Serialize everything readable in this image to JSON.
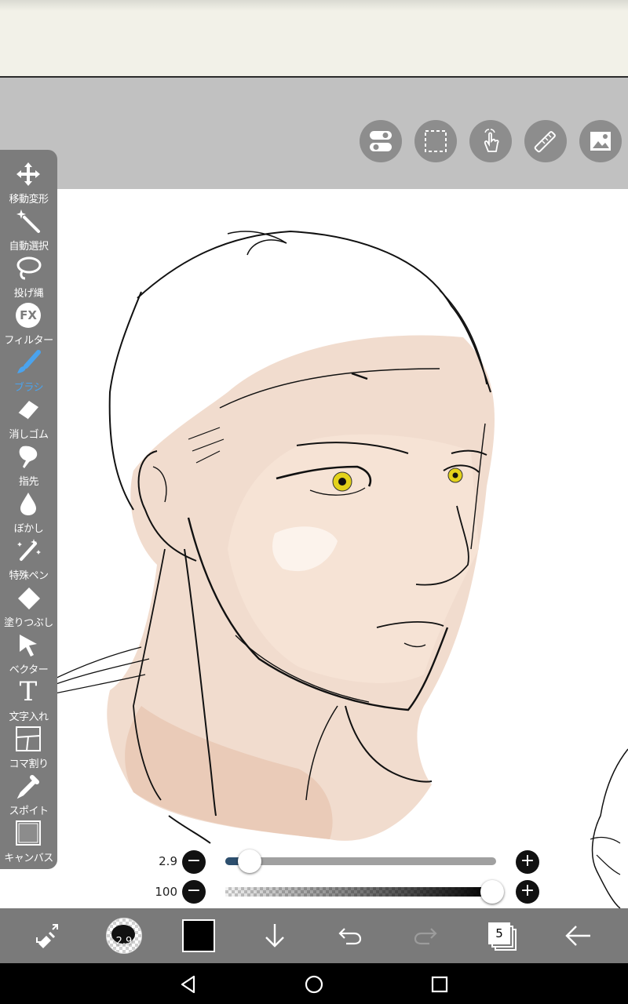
{
  "tools": [
    {
      "label": "移動変形",
      "icon": "move-transform-icon"
    },
    {
      "label": "自動選択",
      "icon": "magic-wand-icon"
    },
    {
      "label": "投げ縄",
      "icon": "lasso-icon"
    },
    {
      "label": "フィルター",
      "icon": "filter-fx-icon",
      "glyph": "FX"
    },
    {
      "label": "ブラシ",
      "icon": "brush-icon",
      "active": true
    },
    {
      "label": "消しゴム",
      "icon": "eraser-icon"
    },
    {
      "label": "指先",
      "icon": "smudge-icon"
    },
    {
      "label": "ぼかし",
      "icon": "blur-icon"
    },
    {
      "label": "特殊ペン",
      "icon": "special-pen-icon"
    },
    {
      "label": "塗りつぶし",
      "icon": "fill-bucket-icon"
    },
    {
      "label": "ベクター",
      "icon": "vector-cursor-icon"
    },
    {
      "label": "文字入れ",
      "icon": "text-icon",
      "glyph": "T"
    },
    {
      "label": "コマ割り",
      "icon": "frame-divider-icon"
    },
    {
      "label": "スポイト",
      "icon": "eyedropper-icon"
    },
    {
      "label": "キャンバス",
      "icon": "canvas-icon"
    }
  ],
  "top_tools": [
    "toggle-icon",
    "selection-marquee-icon",
    "hand-touch-icon",
    "ruler-icon",
    "image-material-icon"
  ],
  "brush": {
    "size_value": "2.9",
    "size_fraction": 0.09,
    "opacity_value": "100",
    "opacity_fraction": 1.0,
    "minus": "−",
    "plus": "+"
  },
  "bottombar": {
    "brush_size_preview": "2.9",
    "current_color": "#000000",
    "layer_count": "5"
  },
  "colors": {
    "accent": "#4aa3ee",
    "toolbox": "#7c7c7c",
    "workspace": "#c1c1c1",
    "skin": "#efd6c6"
  }
}
